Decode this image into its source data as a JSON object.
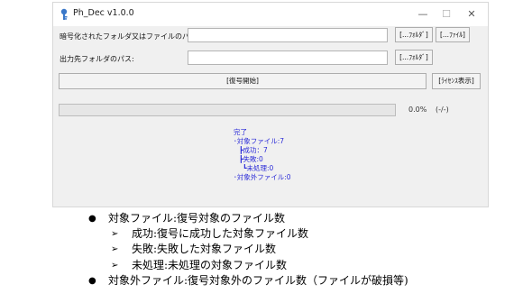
{
  "window": {
    "title": "Ph_Dec v1.0.0",
    "controls": {
      "minimize": "—",
      "maximize": "☐",
      "close": "✕"
    }
  },
  "form": {
    "source_label": "暗号化されたフォルダ又はファイルのパス:",
    "source_value": "",
    "source_folder_button": "[...ﾌｫﾙﾀﾞ]",
    "source_file_button": "[...ﾌｧｲﾙ]",
    "output_label": "出力先フォルダのパス:",
    "output_value": "",
    "output_folder_button": "[...ﾌｫﾙﾀﾞ]",
    "start_button": "[復号開始]",
    "license_button": "[ﾗｲｾﾝｽ表示]"
  },
  "progress": {
    "fraction": 0,
    "percent_text": "0.0%",
    "count_text": "(-/-)"
  },
  "result": {
    "lines": [
      "完了",
      "･対象ファイル:7",
      "┣成功：7",
      "┣失敗:0",
      "┗未処理:0",
      "･対象外ファイル:0"
    ]
  },
  "notes": [
    {
      "level": 1,
      "marker": "●",
      "text": "対象ファイル:復号対象のファイル数"
    },
    {
      "level": 2,
      "marker": "➢",
      "text": "成功:復号に成功した対象ファイル数"
    },
    {
      "level": 2,
      "marker": "➢",
      "text": "失敗:失敗した対象ファイル数"
    },
    {
      "level": 2,
      "marker": "➢",
      "text": "未処理:未処理の対象ファイル数"
    },
    {
      "level": 1,
      "marker": "●",
      "text": "対象外ファイル:復号対象外のファイル数（ファイルが破損等)"
    }
  ],
  "colors": {
    "result_text": "#2b2bd8",
    "window_bg": "#f0f0f0",
    "progress_fill": "#06b025"
  },
  "icons": {
    "app": "key-icon"
  }
}
